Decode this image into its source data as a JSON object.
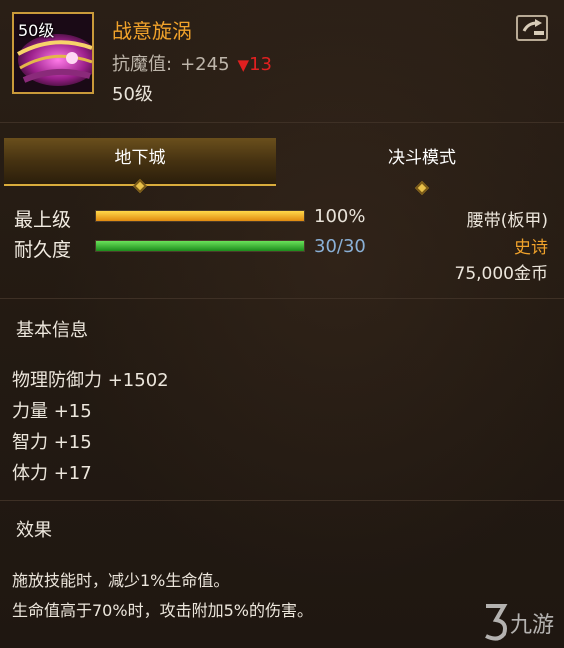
{
  "item": {
    "level_badge": "50级",
    "name": "战意旋涡",
    "resist_label": "抗魔值:",
    "resist_value": "+245",
    "resist_diff": "13",
    "level_text": "50级",
    "type": "腰带(板甲)",
    "rarity": "史诗",
    "price": "75,000金币"
  },
  "tabs": [
    {
      "label": "地下城",
      "active": true
    },
    {
      "label": "决斗模式",
      "active": false
    }
  ],
  "bars": [
    {
      "label": "最上级",
      "value_text": "100%",
      "fraction": 1.0
    },
    {
      "label": "耐久度",
      "value_text": "30/30",
      "fraction": 1.0
    }
  ],
  "basic_info": {
    "title": "基本信息",
    "stats": [
      "物理防御力 +1502",
      "力量 +15",
      "智力 +15",
      "体力 +17"
    ]
  },
  "effect": {
    "title": "效果",
    "lines": [
      "施放技能时，减少1%生命值。",
      "生命值高于70%时，攻击附加5%的伤害。"
    ]
  },
  "watermark": {
    "text": "九游"
  },
  "colors": {
    "accent_gold": "#f0a22b",
    "durability_green": "#3fbf36",
    "grade_orange": "#f0b020",
    "decrease_red": "#e02020",
    "blue_value": "#8ab0d6"
  },
  "icons": [
    "belt-item-icon",
    "share-icon",
    "down-arrow-icon",
    "tab-diamond-icon",
    "jiuyou-logo-icon"
  ]
}
